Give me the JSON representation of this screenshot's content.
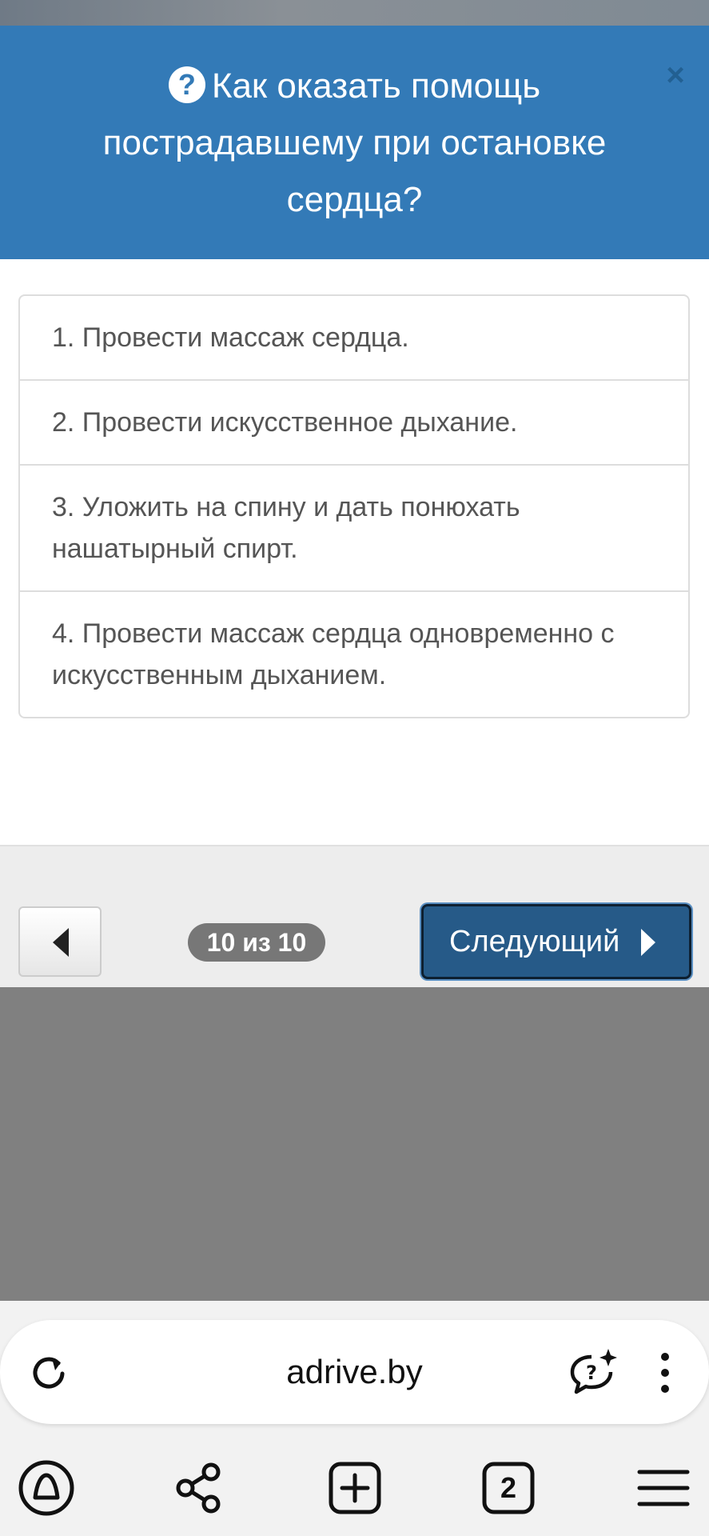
{
  "modal": {
    "title": "Как оказать помощь пострадавшему при остановке сердца?",
    "close_label": "×",
    "header_color": "#337ab7",
    "answers": [
      "1. Провести массаж сердца.",
      "2. Провести искусственное дыхание.",
      "3. Уложить на спину и дать понюхать нашатырный спирт.",
      "4. Провести массаж сердца одновременно с искусственным дыханием."
    ],
    "counter": "10 из 10",
    "next_label": "Следующий",
    "next_color": "#265a88"
  },
  "browser": {
    "url": "adrive.by",
    "tabs_count": "2",
    "icons": [
      "reload-icon",
      "ai-chat-icon",
      "more-vert-icon",
      "alice-icon",
      "share-icon",
      "new-tab-icon",
      "tabs-icon",
      "menu-icon"
    ]
  }
}
